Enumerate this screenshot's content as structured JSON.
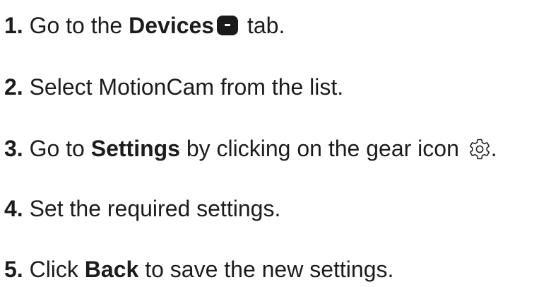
{
  "steps": [
    {
      "num": "1.",
      "t1": " Go to the ",
      "b1": "Devices",
      "t2": " tab.",
      "icon": "devices-icon"
    },
    {
      "num": "2.",
      "t1": " Select MotionCam from the list."
    },
    {
      "num": "3.",
      "t1": " Go to ",
      "b1": "Settings",
      "t2": " by clicking on the gear icon ",
      "t3": ".",
      "icon": "gear-icon"
    },
    {
      "num": "4.",
      "t1": " Set the required settings."
    },
    {
      "num": "5.",
      "t1": " Click ",
      "b1": "Back",
      "t2": " to save the new settings."
    }
  ],
  "colors": {
    "text": "#1c1c1c",
    "icon": "#1a1a1a"
  }
}
